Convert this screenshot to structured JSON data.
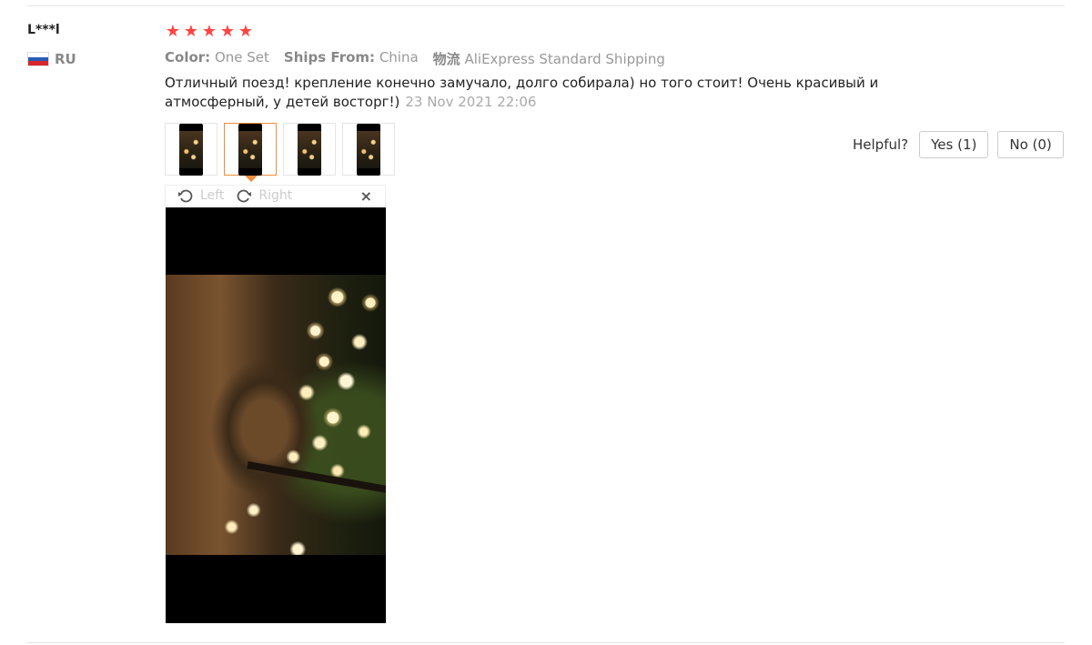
{
  "review": {
    "user_name": "L***l",
    "country_code": "RU",
    "flag_colors": [
      "#ffffff",
      "#2b5bb5",
      "#d9262c"
    ],
    "rating": 5,
    "star_color": "#f44848",
    "meta": {
      "color_label": "Color:",
      "color_value": "One Set",
      "ships_from_label": "Ships From:",
      "ships_from_value": "China",
      "shipping_label": "物流",
      "shipping_value": "AliExpress Standard Shipping"
    },
    "text": "Отличный поезд! крепление конечно замучало, долго собирала) но того стоит! Очень красивый и атмосферный, у детей восторг!)",
    "date": "23 Nov 2021 22:06",
    "thumbnails": [
      {
        "active": false
      },
      {
        "active": true
      },
      {
        "active": false
      },
      {
        "active": false
      }
    ],
    "viewer": {
      "rotate_left_label": "Left",
      "rotate_right_label": "Right",
      "close_icon": "×"
    },
    "helpful": {
      "label": "Helpful?",
      "yes_label": "Yes (1)",
      "no_label": "No (0)"
    }
  }
}
